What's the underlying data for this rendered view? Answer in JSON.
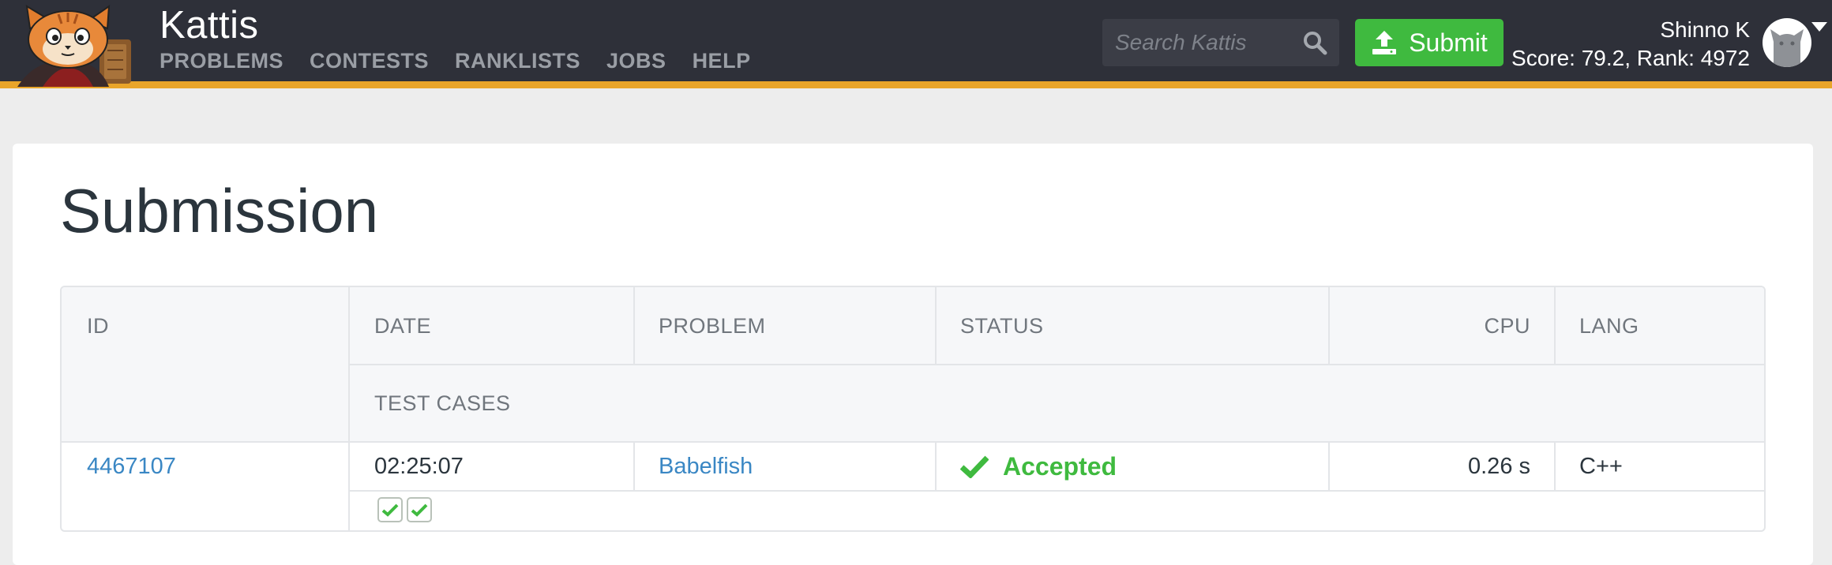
{
  "header": {
    "brand": "Kattis",
    "nav": [
      "PROBLEMS",
      "CONTESTS",
      "RANKLISTS",
      "JOBS",
      "HELP"
    ],
    "search_placeholder": "Search Kattis",
    "submit_label": "Submit",
    "user_name": "Shinno K",
    "user_score": "Score: 79.2, Rank: 4972"
  },
  "page": {
    "title": "Submission"
  },
  "table": {
    "headers": {
      "id": "ID",
      "date": "DATE",
      "problem": "PROBLEM",
      "status": "STATUS",
      "cpu": "CPU",
      "lang": "LANG",
      "test_cases": "TEST CASES"
    },
    "row": {
      "id": "4467107",
      "date": "02:25:07",
      "problem": "Babelfish",
      "status": "Accepted",
      "cpu": "0.26 s",
      "lang": "C++",
      "test_cases_passed": 2,
      "test_cases_total": 2
    }
  },
  "colors": {
    "header_bg": "#2e3039",
    "accent_bar": "#e9a52a",
    "success": "#3fba3f",
    "link": "#3a87c4"
  },
  "icons": {
    "search": "search-icon",
    "submit": "upload-icon",
    "status": "check-icon",
    "dropdown": "caret-down-icon"
  }
}
